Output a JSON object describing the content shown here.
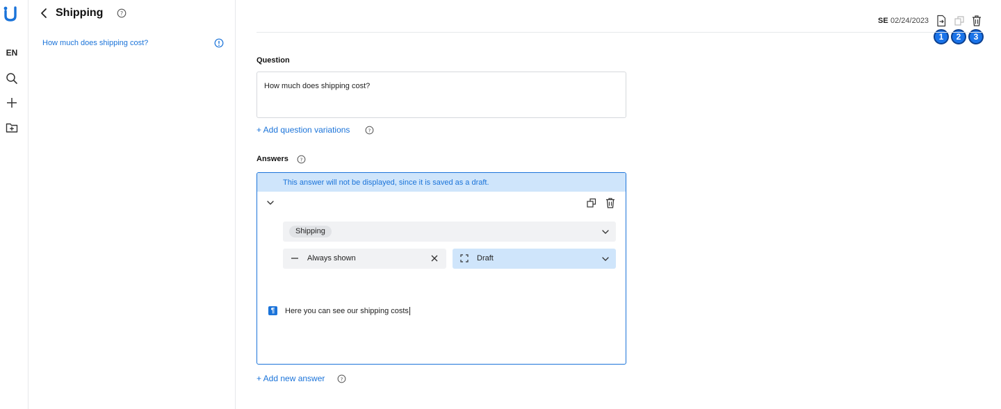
{
  "sidebar": {
    "language": "EN"
  },
  "panel": {
    "title": "Shipping",
    "items": [
      {
        "label": "How much does shipping cost?"
      }
    ]
  },
  "meta": {
    "language": "SE",
    "date": "02/24/2023"
  },
  "badges": [
    "1",
    "2",
    "3"
  ],
  "question": {
    "label": "Question",
    "value": "How much does shipping cost?",
    "add_variations": "+ Add question variations"
  },
  "answers": {
    "label": "Answers",
    "draft_notice": "This answer will not be displayed, since it is saved as a draft.",
    "tag": "Shipping",
    "visibility": "Always shown",
    "status": "Draft",
    "text": "Here you can see our shipping costs",
    "add_new": "+ Add new answer"
  },
  "colors": {
    "accent": "#1a73d9",
    "banner": "#cfe5fb",
    "badge": "#1a73e8"
  }
}
